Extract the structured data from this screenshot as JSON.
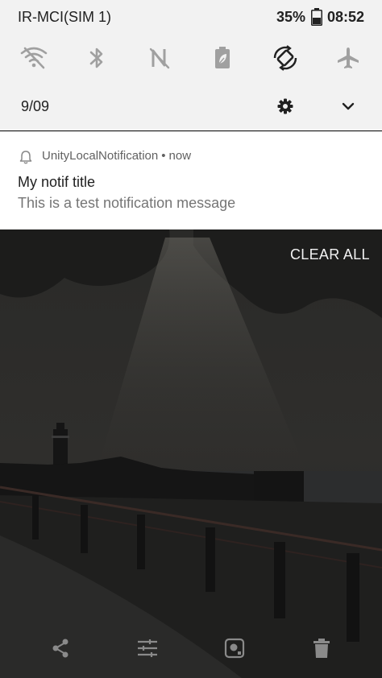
{
  "status_bar": {
    "carrier": "IR-MCI(SIM 1)",
    "battery_percent": "35%",
    "time": "08:52"
  },
  "quick_settings": {
    "tiles": [
      {
        "icon": "wifi-off-icon"
      },
      {
        "icon": "bluetooth-icon"
      },
      {
        "icon": "nfc-off-icon"
      },
      {
        "icon": "battery-saver-icon"
      },
      {
        "icon": "auto-rotate-icon"
      },
      {
        "icon": "airplane-mode-icon"
      }
    ],
    "date": "9/09"
  },
  "notification": {
    "app_name": "UnityLocalNotification",
    "separator": "•",
    "time": "now",
    "title": "My notif title",
    "message": "This is a test notification message"
  },
  "wallpaper_actions": {
    "clear_all": "CLEAR ALL",
    "icons": [
      "share-icon",
      "tune-icon",
      "screenshot-lens-icon",
      "delete-icon"
    ]
  },
  "colors": {
    "shade_bg": "#f2f2f2",
    "card_bg": "#ffffff",
    "text_primary": "#212121",
    "text_secondary": "#757575",
    "icon_inactive": "#a0a0a0",
    "icon_active": "#212121"
  }
}
